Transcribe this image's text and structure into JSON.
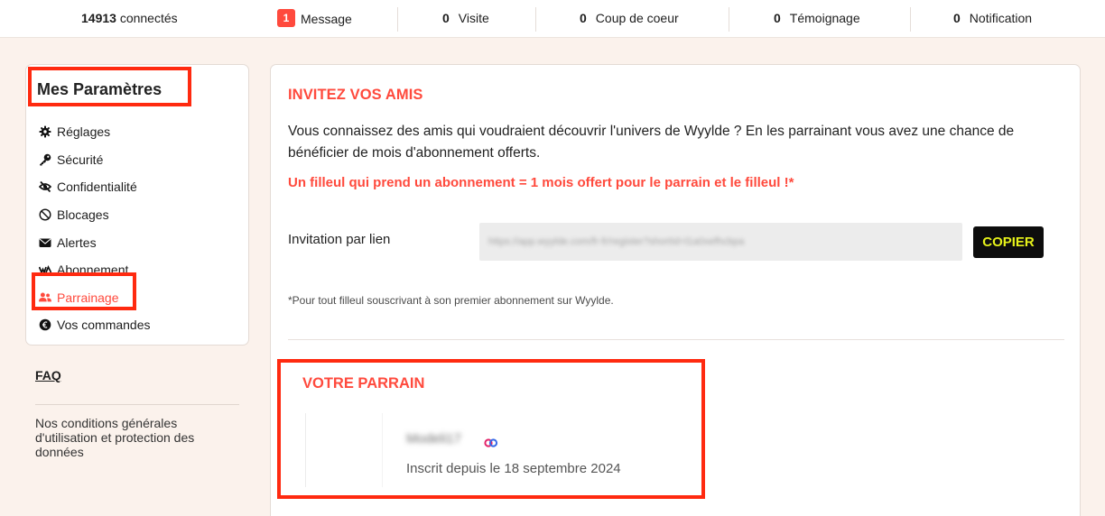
{
  "topbar": {
    "online_count": "14913",
    "online_label": "connectés",
    "messages": {
      "count": "1",
      "label": "Message"
    },
    "visits": {
      "count": "0",
      "label": "Visite"
    },
    "favorites": {
      "count": "0",
      "label": "Coup de coeur"
    },
    "testimonials": {
      "count": "0",
      "label": "Témoignage"
    },
    "notifications": {
      "count": "0",
      "label": "Notification"
    }
  },
  "sidebar": {
    "title": "Mes Paramètres",
    "items": [
      {
        "label": "Réglages",
        "icon": "gear-icon"
      },
      {
        "label": "Sécurité",
        "icon": "key-icon"
      },
      {
        "label": "Confidentialité",
        "icon": "eye-slash-icon"
      },
      {
        "label": "Blocages",
        "icon": "ban-icon"
      },
      {
        "label": "Alertes",
        "icon": "envelope-icon"
      },
      {
        "label": "Abonnement",
        "icon": "wyylde-logo-icon"
      },
      {
        "label": "Parrainage",
        "icon": "users-icon",
        "active": true
      },
      {
        "label": "Vos commandes",
        "icon": "euro-icon"
      }
    ],
    "faq": "FAQ",
    "conditions": "Nos conditions générales d'utilisation et protection des données"
  },
  "invite": {
    "title": "INVITEZ VOS AMIS",
    "description": "Vous connaissez des amis qui voudraient découvrir l'univers de Wyylde ? En les parrainant vous avez une chance de bénéficier de mois d'abonnement offerts.",
    "promo": "Un filleul qui prend un abonnement = 1 mois offert pour le parrain et le filleul !*",
    "link_label": "Invitation par lien",
    "link_value": "https://app.wyylde.com/fr-fr/register?shortId=l1a0xefhcbpa",
    "copy_label": "COPIER",
    "footnote": "*Pour tout filleul souscrivant à son premier abonnement sur Wyylde."
  },
  "sponsor": {
    "title": "VOTRE PARRAIN",
    "name": "Modeli17",
    "since": "Inscrit depuis le 18 septembre 2024"
  },
  "colors": {
    "accent": "#ff4a3d",
    "highlight_box": "#ff2a10",
    "background": "#fbf2ec",
    "copy_button_text": "#e6f21a"
  }
}
